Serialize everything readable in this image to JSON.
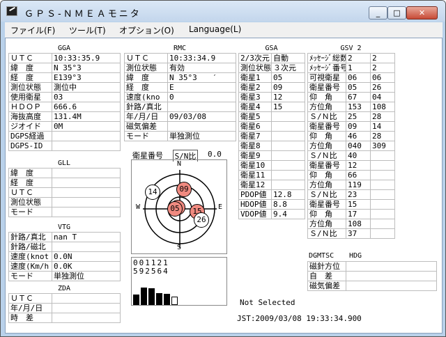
{
  "window": {
    "title": "ＧＰＳ-ＮＭＥＡモニタ",
    "min": "_",
    "max": "□",
    "close": "✕"
  },
  "menu": [
    "ファイル(F)",
    "ツール(T)",
    "オプション(O)",
    "Language(L)"
  ],
  "gga": {
    "title": "GGA",
    "rows": [
      [
        "ＵＴＣ",
        "10:33:35.9"
      ],
      [
        "緯　度",
        "N 35°3"
      ],
      [
        "経　度",
        "E139°3"
      ],
      [
        "測位状態",
        "測位中"
      ],
      [
        "使用衛星",
        "03"
      ],
      [
        "ＨＤＯＰ",
        "666.6"
      ],
      [
        "海抜高度",
        "131.4M"
      ],
      [
        "ジオイド",
        "0M"
      ],
      [
        "DGPS経過",
        ""
      ],
      [
        "DGPS-ID",
        ""
      ]
    ]
  },
  "rmc": {
    "title": "RMC",
    "rows": [
      [
        "ＵＴＣ",
        "10:33:34.9"
      ],
      [
        "測位状態",
        "有効"
      ],
      [
        "緯　度",
        "N 35°3　　′"
      ],
      [
        "経　度",
        "E"
      ],
      [
        "速度(kno",
        "0"
      ],
      [
        "針路/真北",
        ""
      ],
      [
        "年/月/日",
        "09/03/08"
      ],
      [
        "磁気偏差",
        ""
      ],
      [
        "モード",
        "単独測位"
      ]
    ]
  },
  "gsa": {
    "title": "GSA",
    "rows": [
      [
        "2/3次元",
        "自動"
      ],
      [
        "測位状態",
        "３次元"
      ],
      [
        "衛星1",
        "05"
      ],
      [
        "衛星2",
        "09"
      ],
      [
        "衛星3",
        "12"
      ],
      [
        "衛星4",
        "15"
      ],
      [
        "衛星5",
        ""
      ],
      [
        "衛星6",
        ""
      ],
      [
        "衛星7",
        ""
      ],
      [
        "衛星8",
        ""
      ],
      [
        "衛星9",
        ""
      ],
      [
        "衛星10",
        ""
      ],
      [
        "衛星11",
        ""
      ],
      [
        "衛星12",
        ""
      ],
      [
        "PDOP値",
        "12.8"
      ],
      [
        "HDOP値",
        "8.8"
      ],
      [
        "VDOP値",
        "9.4"
      ]
    ]
  },
  "gsv": {
    "title": "GSV 2",
    "rows": [
      [
        "ﾒｯｾｰｼﾞ総数",
        "2",
        "2"
      ],
      [
        "ﾒｯｾｰｼﾞ番号",
        "1",
        "2"
      ],
      [
        "可視衛星",
        "06",
        "06"
      ],
      [
        "衛星番号",
        "05",
        "26"
      ],
      [
        "仰　角",
        "67",
        "04"
      ],
      [
        "方位角",
        "153",
        "108"
      ],
      [
        "Ｓ/Ｎ比",
        "25",
        "28"
      ],
      [
        "衛星番号",
        "09",
        "14"
      ],
      [
        "仰　角",
        "46",
        "28"
      ],
      [
        "方位角",
        "040",
        "309"
      ],
      [
        "Ｓ/Ｎ比",
        "40",
        ""
      ],
      [
        "衛星番号",
        "12",
        ""
      ],
      [
        "仰　角",
        "66",
        ""
      ],
      [
        "方位角",
        "119",
        ""
      ],
      [
        "Ｓ/Ｎ比",
        "23",
        ""
      ],
      [
        "衛星番号",
        "15",
        ""
      ],
      [
        "仰　角",
        "17",
        ""
      ],
      [
        "方位角",
        "108",
        ""
      ],
      [
        "Ｓ/Ｎ比",
        "37",
        ""
      ]
    ]
  },
  "gll": {
    "title": "GLL",
    "rows": [
      [
        "緯　度",
        ""
      ],
      [
        "経　度",
        ""
      ],
      [
        "ＵＴＣ",
        ""
      ],
      [
        "測位状態",
        ""
      ],
      [
        "モード",
        ""
      ]
    ]
  },
  "vtg": {
    "title": "VTG",
    "rows": [
      [
        "針路/真北",
        "nan T"
      ],
      [
        "針路/磁北",
        ""
      ],
      [
        "速度(knot",
        "0.0N"
      ],
      [
        "速度(Km/h",
        "0.0K"
      ],
      [
        "モード",
        "単独測位"
      ]
    ]
  },
  "zda": {
    "title": "ZDA",
    "rows": [
      [
        "ＵＴＣ",
        ""
      ],
      [
        "年/月/日",
        ""
      ],
      [
        "時　差",
        ""
      ]
    ]
  },
  "dgmtsc": {
    "title": "DGMTSC",
    "title2": "HDG",
    "rows": [
      [
        "磁針方位",
        ""
      ],
      [
        "自　差",
        ""
      ],
      [
        "磁気偏差",
        ""
      ]
    ]
  },
  "sky": {
    "tab1": "衛星番号",
    "tab2": "S/N比",
    "value": "0.0",
    "n": "N",
    "e": "E",
    "s": "S",
    "w": "W",
    "sats": [
      {
        "id": "09",
        "hl": true
      },
      {
        "id": "12",
        "hl": true
      },
      {
        "id": "05",
        "hl": true
      },
      {
        "id": "15",
        "hl": true
      },
      {
        "id": "14",
        "hl": false
      },
      {
        "id": "26",
        "hl": false
      }
    ]
  },
  "snr": {
    "ids_top": "001121",
    "ids_bot": "592564",
    "levels": [
      0.4,
      0.65,
      0.62,
      0.45,
      0.43,
      0.32
    ]
  },
  "status": {
    "selected": "Not Selected",
    "jst": "JST:2009/03/08 19:33:34.900"
  }
}
